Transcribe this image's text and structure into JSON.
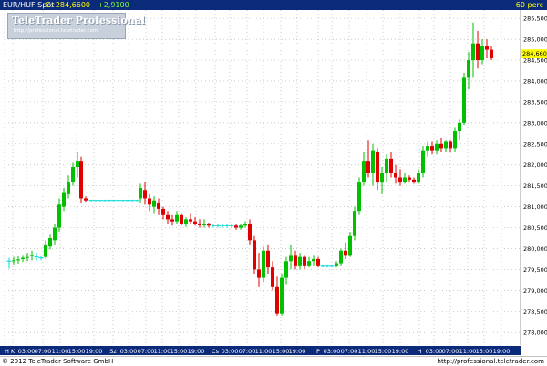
{
  "header": {
    "instrument": "EUR/HUF Spot",
    "close_label": "C: 284,6600",
    "change": "+2,9100",
    "period": "60 perc"
  },
  "logo": {
    "name": "TeleTrader Professional",
    "url": "http://professional.teletrader.com"
  },
  "footer": {
    "copyright": "© 2012 TeleTrader Software GmbH",
    "source_url": "http://professional.teletrader.com"
  },
  "colors": {
    "header_bg": "#0b2a7a",
    "up": "#00c000",
    "down": "#e00000",
    "flat": "#00d8d8",
    "axis_bg": "#0b2a7a",
    "last_price_bg": "#ffff00"
  },
  "chart_data": {
    "type": "candlestick",
    "ylim": [
      277.7,
      285.7
    ],
    "y_ticks": [
      "278,0000",
      "278,5000",
      "279,0000",
      "279,5000",
      "280,0000",
      "280,5000",
      "281,0000",
      "281,5000",
      "282,0000",
      "282,5000",
      "283,0000",
      "283,5000",
      "284,0000",
      "284,5000",
      "285,0000",
      "285,5000"
    ],
    "last_price": "284,6600",
    "x_labels": [
      "H",
      "K",
      "03:00",
      "07:00",
      "11:00",
      "15:00",
      "19:00",
      "Sz",
      "03:00",
      "07:00",
      "11:00",
      "15:00",
      "19:00",
      "Cs",
      "03:00",
      "07:00",
      "11:00",
      "15:00",
      "19:00",
      "P",
      "03:00",
      "07:00",
      "11:00",
      "15:00",
      "19:00",
      "H",
      "03:00",
      "07:00",
      "11:00",
      "15:00",
      "19:00"
    ],
    "x_label_pos": [
      5,
      14,
      29,
      47,
      66,
      84,
      103,
      124,
      141,
      160,
      178,
      196,
      215,
      236,
      252,
      271,
      289,
      308,
      326,
      349,
      364,
      383,
      402,
      420,
      439,
      460,
      476,
      494,
      513,
      531,
      550
    ],
    "grid": true,
    "candles": [
      {
        "x": 10,
        "o": 279.7,
        "h": 279.78,
        "l": 279.52,
        "c": 279.7
      },
      {
        "x": 15,
        "o": 279.7,
        "h": 279.8,
        "l": 279.62,
        "c": 279.72
      },
      {
        "x": 20,
        "o": 279.72,
        "h": 279.82,
        "l": 279.64,
        "c": 279.74
      },
      {
        "x": 25,
        "o": 279.75,
        "h": 279.85,
        "l": 279.68,
        "c": 279.78
      },
      {
        "x": 30,
        "o": 279.78,
        "h": 279.9,
        "l": 279.7,
        "c": 279.8
      },
      {
        "x": 35,
        "o": 279.82,
        "h": 279.95,
        "l": 279.72,
        "c": 279.85
      },
      {
        "x": 40,
        "o": 279.8,
        "h": 279.9,
        "l": 279.72,
        "c": 279.8
      },
      {
        "x": 45,
        "o": 279.78,
        "h": 279.82,
        "l": 279.72,
        "c": 279.78
      },
      {
        "x": 50,
        "o": 279.8,
        "h": 280.2,
        "l": 279.76,
        "c": 280.1
      },
      {
        "x": 55,
        "o": 280.05,
        "h": 280.35,
        "l": 279.98,
        "c": 280.25
      },
      {
        "x": 60,
        "o": 280.2,
        "h": 280.6,
        "l": 280.1,
        "c": 280.5
      },
      {
        "x": 65,
        "o": 280.5,
        "h": 281.2,
        "l": 280.4,
        "c": 281.05
      },
      {
        "x": 70,
        "o": 281.0,
        "h": 281.45,
        "l": 280.9,
        "c": 281.35
      },
      {
        "x": 75,
        "o": 281.3,
        "h": 281.75,
        "l": 281.2,
        "c": 281.6
      },
      {
        "x": 80,
        "o": 281.6,
        "h": 282.05,
        "l": 281.5,
        "c": 281.95
      },
      {
        "x": 85,
        "o": 281.95,
        "h": 282.3,
        "l": 281.7,
        "c": 282.1
      },
      {
        "x": 89,
        "o": 282.1,
        "h": 282.2,
        "l": 281.1,
        "c": 281.2
      },
      {
        "x": 94,
        "o": 281.2,
        "h": 281.25,
        "l": 281.12,
        "c": 281.15
      },
      {
        "x": 100,
        "o": 281.15,
        "h": 281.17,
        "l": 281.13,
        "c": 281.15
      },
      {
        "x": 105,
        "o": 281.15,
        "h": 281.17,
        "l": 281.13,
        "c": 281.15
      },
      {
        "x": 110,
        "o": 281.15,
        "h": 281.17,
        "l": 281.13,
        "c": 281.15
      },
      {
        "x": 115,
        "o": 281.15,
        "h": 281.17,
        "l": 281.13,
        "c": 281.15
      },
      {
        "x": 120,
        "o": 281.15,
        "h": 281.17,
        "l": 281.13,
        "c": 281.15
      },
      {
        "x": 125,
        "o": 281.15,
        "h": 281.17,
        "l": 281.13,
        "c": 281.15
      },
      {
        "x": 130,
        "o": 281.15,
        "h": 281.17,
        "l": 281.13,
        "c": 281.15
      },
      {
        "x": 135,
        "o": 281.15,
        "h": 281.17,
        "l": 281.13,
        "c": 281.15
      },
      {
        "x": 140,
        "o": 281.15,
        "h": 281.17,
        "l": 281.13,
        "c": 281.15
      },
      {
        "x": 145,
        "o": 281.15,
        "h": 281.17,
        "l": 281.13,
        "c": 281.15
      },
      {
        "x": 150,
        "o": 281.15,
        "h": 281.17,
        "l": 281.13,
        "c": 281.15
      },
      {
        "x": 154,
        "o": 281.2,
        "h": 281.55,
        "l": 281.1,
        "c": 281.45
      },
      {
        "x": 159,
        "o": 281.4,
        "h": 281.6,
        "l": 281.05,
        "c": 281.2
      },
      {
        "x": 164,
        "o": 281.2,
        "h": 281.3,
        "l": 280.9,
        "c": 281.05
      },
      {
        "x": 169,
        "o": 281.0,
        "h": 281.25,
        "l": 280.85,
        "c": 281.15
      },
      {
        "x": 174,
        "o": 281.1,
        "h": 281.2,
        "l": 280.8,
        "c": 280.95
      },
      {
        "x": 179,
        "o": 280.95,
        "h": 281.0,
        "l": 280.7,
        "c": 280.8
      },
      {
        "x": 184,
        "o": 280.8,
        "h": 280.9,
        "l": 280.6,
        "c": 280.7
      },
      {
        "x": 189,
        "o": 280.7,
        "h": 280.8,
        "l": 280.55,
        "c": 280.65
      },
      {
        "x": 194,
        "o": 280.65,
        "h": 280.9,
        "l": 280.6,
        "c": 280.8
      },
      {
        "x": 199,
        "o": 280.8,
        "h": 280.85,
        "l": 280.55,
        "c": 280.6
      },
      {
        "x": 204,
        "o": 280.6,
        "h": 280.75,
        "l": 280.52,
        "c": 280.7
      },
      {
        "x": 209,
        "o": 280.7,
        "h": 280.85,
        "l": 280.6,
        "c": 280.65
      },
      {
        "x": 214,
        "o": 280.65,
        "h": 280.75,
        "l": 280.55,
        "c": 280.6
      },
      {
        "x": 219,
        "o": 280.6,
        "h": 280.7,
        "l": 280.5,
        "c": 280.58
      },
      {
        "x": 224,
        "o": 280.58,
        "h": 280.7,
        "l": 280.5,
        "c": 280.6
      },
      {
        "x": 229,
        "o": 280.6,
        "h": 280.62,
        "l": 280.5,
        "c": 280.55
      },
      {
        "x": 234,
        "o": 280.55,
        "h": 280.6,
        "l": 280.5,
        "c": 280.55
      },
      {
        "x": 239,
        "o": 280.55,
        "h": 280.6,
        "l": 280.5,
        "c": 280.55
      },
      {
        "x": 244,
        "o": 280.55,
        "h": 280.6,
        "l": 280.5,
        "c": 280.55
      },
      {
        "x": 249,
        "o": 280.55,
        "h": 280.6,
        "l": 280.5,
        "c": 280.55
      },
      {
        "x": 254,
        "o": 280.55,
        "h": 280.6,
        "l": 280.5,
        "c": 280.55
      },
      {
        "x": 259,
        "o": 280.55,
        "h": 280.6,
        "l": 280.45,
        "c": 280.5
      },
      {
        "x": 264,
        "o": 280.5,
        "h": 280.6,
        "l": 280.45,
        "c": 280.55
      },
      {
        "x": 269,
        "o": 280.55,
        "h": 280.65,
        "l": 280.5,
        "c": 280.6
      },
      {
        "x": 274,
        "o": 280.6,
        "h": 280.7,
        "l": 280.1,
        "c": 280.2
      },
      {
        "x": 279,
        "o": 280.2,
        "h": 280.3,
        "l": 279.4,
        "c": 279.5
      },
      {
        "x": 284,
        "o": 279.5,
        "h": 279.9,
        "l": 279.1,
        "c": 279.3
      },
      {
        "x": 289,
        "o": 279.3,
        "h": 280.05,
        "l": 279.2,
        "c": 279.95
      },
      {
        "x": 294,
        "o": 279.95,
        "h": 280.1,
        "l": 279.4,
        "c": 279.55
      },
      {
        "x": 299,
        "o": 279.55,
        "h": 279.7,
        "l": 279.0,
        "c": 279.1
      },
      {
        "x": 304,
        "o": 279.1,
        "h": 279.35,
        "l": 278.4,
        "c": 278.45
      },
      {
        "x": 309,
        "o": 278.45,
        "h": 279.4,
        "l": 278.4,
        "c": 279.3
      },
      {
        "x": 314,
        "o": 279.3,
        "h": 279.8,
        "l": 279.15,
        "c": 279.7
      },
      {
        "x": 319,
        "o": 279.7,
        "h": 280.1,
        "l": 279.5,
        "c": 279.85
      },
      {
        "x": 324,
        "o": 279.85,
        "h": 279.95,
        "l": 279.5,
        "c": 279.6
      },
      {
        "x": 329,
        "o": 279.6,
        "h": 279.9,
        "l": 279.5,
        "c": 279.8
      },
      {
        "x": 334,
        "o": 279.8,
        "h": 279.85,
        "l": 279.5,
        "c": 279.6
      },
      {
        "x": 339,
        "o": 279.6,
        "h": 279.8,
        "l": 279.55,
        "c": 279.7
      },
      {
        "x": 344,
        "o": 279.7,
        "h": 279.85,
        "l": 279.6,
        "c": 279.75
      },
      {
        "x": 349,
        "o": 279.75,
        "h": 279.8,
        "l": 279.55,
        "c": 279.6
      },
      {
        "x": 354,
        "o": 279.6,
        "h": 279.62,
        "l": 279.55,
        "c": 279.6
      },
      {
        "x": 359,
        "o": 279.6,
        "h": 279.62,
        "l": 279.55,
        "c": 279.6
      },
      {
        "x": 364,
        "o": 279.6,
        "h": 279.62,
        "l": 279.55,
        "c": 279.6
      },
      {
        "x": 369,
        "o": 279.6,
        "h": 279.7,
        "l": 279.55,
        "c": 279.65
      },
      {
        "x": 374,
        "o": 279.65,
        "h": 280.0,
        "l": 279.6,
        "c": 279.95
      },
      {
        "x": 379,
        "o": 279.95,
        "h": 280.15,
        "l": 279.75,
        "c": 279.85
      },
      {
        "x": 384,
        "o": 279.85,
        "h": 280.4,
        "l": 279.8,
        "c": 280.3
      },
      {
        "x": 389,
        "o": 280.3,
        "h": 281.0,
        "l": 280.2,
        "c": 280.9
      },
      {
        "x": 394,
        "o": 280.9,
        "h": 281.7,
        "l": 280.8,
        "c": 281.6
      },
      {
        "x": 399,
        "o": 281.6,
        "h": 282.3,
        "l": 281.5,
        "c": 282.1
      },
      {
        "x": 404,
        "o": 282.1,
        "h": 282.6,
        "l": 281.7,
        "c": 281.8
      },
      {
        "x": 409,
        "o": 281.8,
        "h": 282.5,
        "l": 281.5,
        "c": 282.35
      },
      {
        "x": 414,
        "o": 282.3,
        "h": 282.4,
        "l": 281.4,
        "c": 281.6
      },
      {
        "x": 419,
        "o": 281.6,
        "h": 281.95,
        "l": 281.3,
        "c": 281.8
      },
      {
        "x": 424,
        "o": 281.8,
        "h": 282.25,
        "l": 281.6,
        "c": 282.15
      },
      {
        "x": 429,
        "o": 282.15,
        "h": 282.3,
        "l": 281.7,
        "c": 281.8
      },
      {
        "x": 434,
        "o": 281.8,
        "h": 282.0,
        "l": 281.55,
        "c": 281.7
      },
      {
        "x": 439,
        "o": 281.7,
        "h": 281.9,
        "l": 281.5,
        "c": 281.6
      },
      {
        "x": 444,
        "o": 281.6,
        "h": 281.8,
        "l": 281.55,
        "c": 281.7
      },
      {
        "x": 449,
        "o": 281.7,
        "h": 281.75,
        "l": 281.6,
        "c": 281.65
      },
      {
        "x": 454,
        "o": 281.65,
        "h": 281.7,
        "l": 281.55,
        "c": 281.6
      },
      {
        "x": 459,
        "o": 281.6,
        "h": 281.9,
        "l": 281.55,
        "c": 281.8
      },
      {
        "x": 464,
        "o": 281.8,
        "h": 282.45,
        "l": 281.7,
        "c": 282.35
      },
      {
        "x": 469,
        "o": 282.35,
        "h": 282.55,
        "l": 282.2,
        "c": 282.45
      },
      {
        "x": 474,
        "o": 282.45,
        "h": 282.55,
        "l": 282.25,
        "c": 282.35
      },
      {
        "x": 479,
        "o": 282.35,
        "h": 282.6,
        "l": 282.25,
        "c": 282.5
      },
      {
        "x": 484,
        "o": 282.5,
        "h": 282.65,
        "l": 282.3,
        "c": 282.4
      },
      {
        "x": 489,
        "o": 282.4,
        "h": 282.6,
        "l": 282.3,
        "c": 282.55
      },
      {
        "x": 494,
        "o": 282.55,
        "h": 282.6,
        "l": 282.3,
        "c": 282.4
      },
      {
        "x": 499,
        "o": 282.4,
        "h": 282.9,
        "l": 282.3,
        "c": 282.8
      },
      {
        "x": 504,
        "o": 282.8,
        "h": 283.1,
        "l": 282.6,
        "c": 283.0
      },
      {
        "x": 509,
        "o": 283.0,
        "h": 284.2,
        "l": 282.95,
        "c": 284.1
      },
      {
        "x": 514,
        "o": 284.1,
        "h": 284.7,
        "l": 283.8,
        "c": 284.5
      },
      {
        "x": 519,
        "o": 284.5,
        "h": 285.4,
        "l": 284.1,
        "c": 284.9
      },
      {
        "x": 524,
        "o": 284.9,
        "h": 285.2,
        "l": 284.3,
        "c": 284.5
      },
      {
        "x": 529,
        "o": 284.5,
        "h": 285.0,
        "l": 284.4,
        "c": 284.85
      },
      {
        "x": 534,
        "o": 284.85,
        "h": 285.0,
        "l": 284.55,
        "c": 284.75
      },
      {
        "x": 539,
        "o": 284.75,
        "h": 284.85,
        "l": 284.5,
        "c": 284.55
      }
    ]
  }
}
